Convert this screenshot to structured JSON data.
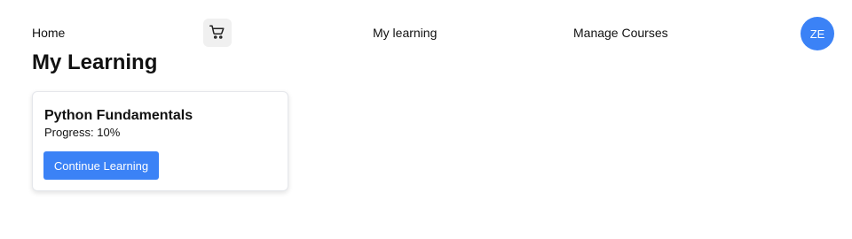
{
  "nav": {
    "home_label": "Home",
    "cart_icon": "cart-icon",
    "my_learning_label": "My learning",
    "manage_courses_label": "Manage Courses",
    "avatar_initials": "ZE",
    "avatar_color": "#3b82f6"
  },
  "page": {
    "title": "My Learning"
  },
  "courses": [
    {
      "title": "Python Fundamentals",
      "progress_text": "Progress: 10%",
      "progress": 0.1,
      "button_label": "Continue Learning"
    }
  ],
  "colors": {
    "accent": "#3b82f6",
    "icon_button_bg": "#f0f0f0"
  }
}
